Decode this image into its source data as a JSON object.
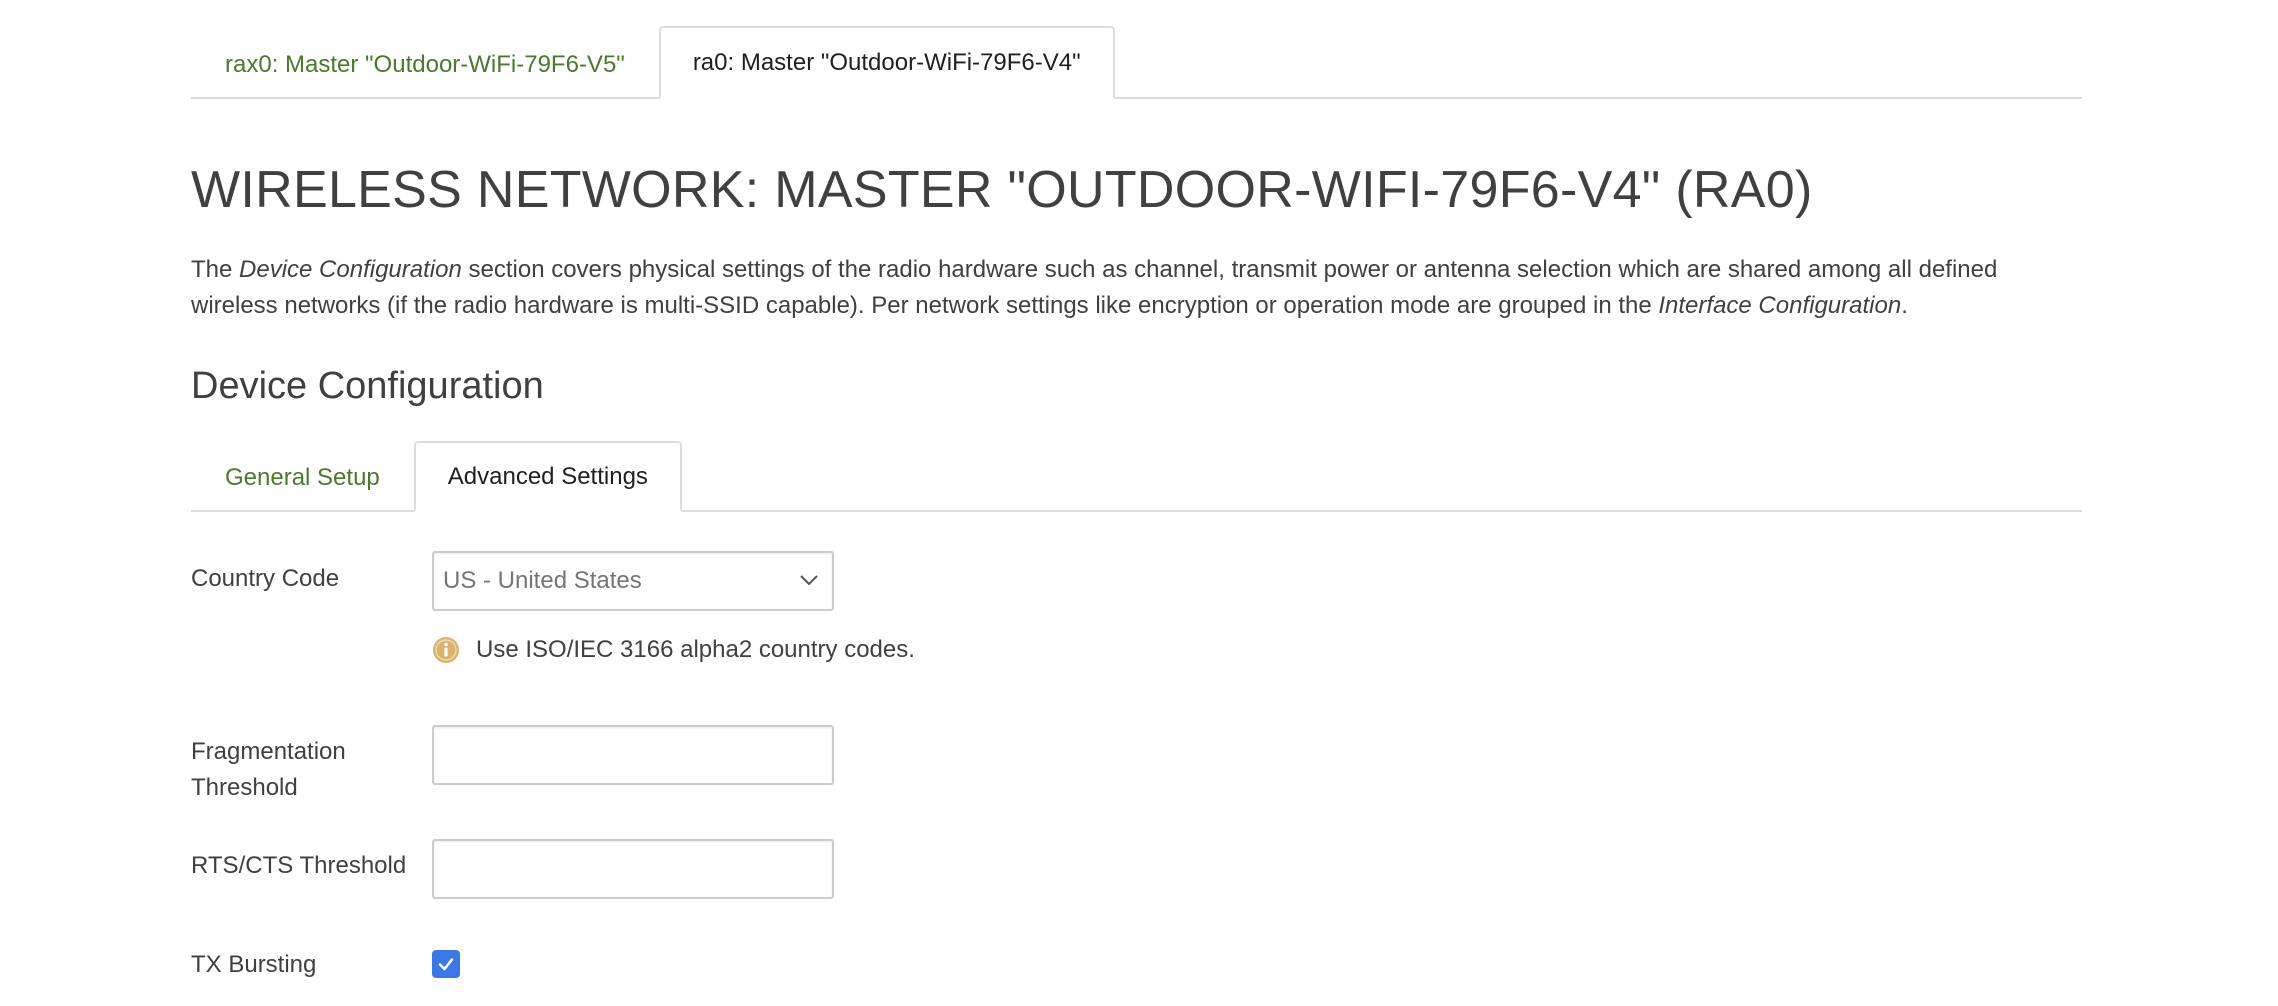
{
  "iface_tabs": [
    {
      "label": "rax0: Master \"Outdoor-WiFi-79F6-V5\"",
      "active": false
    },
    {
      "label": "ra0: Master \"Outdoor-WiFi-79F6-V4\"",
      "active": true
    }
  ],
  "page_title": "WIRELESS NETWORK: MASTER \"OUTDOOR-WIFI-79F6-V4\" (RA0)",
  "description": {
    "p1": "The ",
    "em1": "Device Configuration",
    "p2": " section covers physical settings of the radio hardware such as channel, transmit power or antenna selection which are shared among all defined wireless networks (if the radio hardware is multi-SSID capable). Per network settings like encryption or operation mode are grouped in the ",
    "em2": "Interface Configuration",
    "p3": "."
  },
  "section_title": "Device Configuration",
  "config_tabs": [
    {
      "label": "General Setup",
      "active": false
    },
    {
      "label": "Advanced Settings",
      "active": true
    }
  ],
  "form": {
    "country_code": {
      "label": "Country Code",
      "value": "US - United States",
      "hint": "Use ISO/IEC 3166 alpha2 country codes."
    },
    "fragmentation_threshold": {
      "label_line1": "Fragmentation",
      "label_line2": "Threshold",
      "value": ""
    },
    "rts_cts_threshold": {
      "label": "RTS/CTS Threshold",
      "value": ""
    },
    "tx_bursting": {
      "label": "TX Bursting",
      "checked": true
    }
  },
  "colors": {
    "tab_link": "#4a7a2b",
    "accent_checkbox": "#3b78e7",
    "info_icon": "#d9b46c"
  },
  "icons": {
    "select_chevron": "chevron-down-icon",
    "hint": "info-icon",
    "checkbox": "checkmark-icon"
  }
}
